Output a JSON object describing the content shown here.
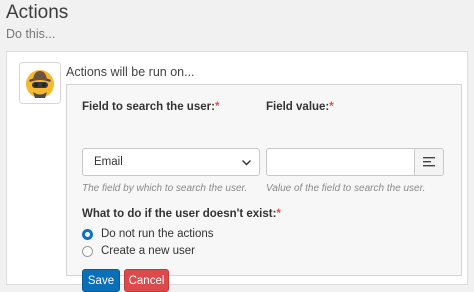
{
  "page": {
    "title": "Actions",
    "subtitle": "Do this..."
  },
  "card": {
    "avatar_icon": "spy-icon",
    "header": "Actions will be run on..."
  },
  "form": {
    "field_search": {
      "label": "Field to search the user:",
      "required_mark": "*",
      "value": "Email",
      "help": "The field by which to search the user."
    },
    "field_value": {
      "label": "Field value:",
      "required_mark": "*",
      "value": "",
      "addon_icon": "text-align-icon",
      "help": "Value of the field to search the user."
    },
    "missing_user": {
      "label": "What to do if the user doesn't exist:",
      "required_mark": "*",
      "options": [
        {
          "label": "Do not run the actions",
          "checked": true
        },
        {
          "label": "Create a new user",
          "checked": false
        }
      ]
    },
    "buttons": {
      "save": "Save",
      "cancel": "Cancel"
    }
  },
  "colors": {
    "primary": "#0a6fb7",
    "danger": "#db4b4b",
    "required": "#d9534f"
  }
}
